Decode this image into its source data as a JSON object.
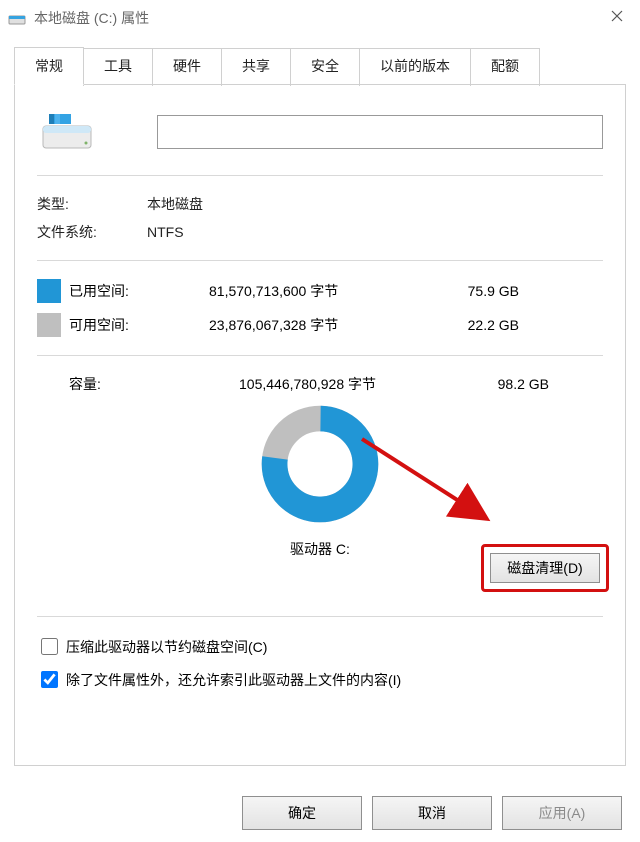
{
  "window": {
    "title": "本地磁盘 (C:) 属性"
  },
  "tabs": [
    {
      "label": "常规",
      "active": true
    },
    {
      "label": "工具",
      "active": false
    },
    {
      "label": "硬件",
      "active": false
    },
    {
      "label": "共享",
      "active": false
    },
    {
      "label": "安全",
      "active": false
    },
    {
      "label": "以前的版本",
      "active": false
    },
    {
      "label": "配额",
      "active": false
    }
  ],
  "drive": {
    "name_value": "",
    "type_label": "类型:",
    "type_value": "本地磁盘",
    "fs_label": "文件系统:",
    "fs_value": "NTFS"
  },
  "space": {
    "used_label": "已用空间:",
    "used_bytes": "81,570,713,600 字节",
    "used_gb": "75.9 GB",
    "free_label": "可用空间:",
    "free_bytes": "23,876,067,328 字节",
    "free_gb": "22.2 GB",
    "cap_label": "容量:",
    "cap_bytes": "105,446,780,928 字节",
    "cap_gb": "98.2 GB"
  },
  "chart_data": {
    "type": "pie",
    "title": "驱动器 C:",
    "series": [
      {
        "name": "已用空间",
        "value": 75.9,
        "color": "#2196d6"
      },
      {
        "name": "可用空间",
        "value": 22.2,
        "color": "#bfbfbf"
      }
    ]
  },
  "drive_label": "驱动器 C:",
  "cleanup_button": "磁盘清理(D)",
  "checkbox1": {
    "label": "压缩此驱动器以节约磁盘空间(C)",
    "checked": false
  },
  "checkbox2": {
    "label": "除了文件属性外，还允许索引此驱动器上文件的内容(I)",
    "checked": true
  },
  "footer": {
    "ok": "确定",
    "cancel": "取消",
    "apply": "应用(A)"
  },
  "colors": {
    "used": "#2196d6",
    "free": "#bfbfbf",
    "highlight": "#d31010"
  }
}
